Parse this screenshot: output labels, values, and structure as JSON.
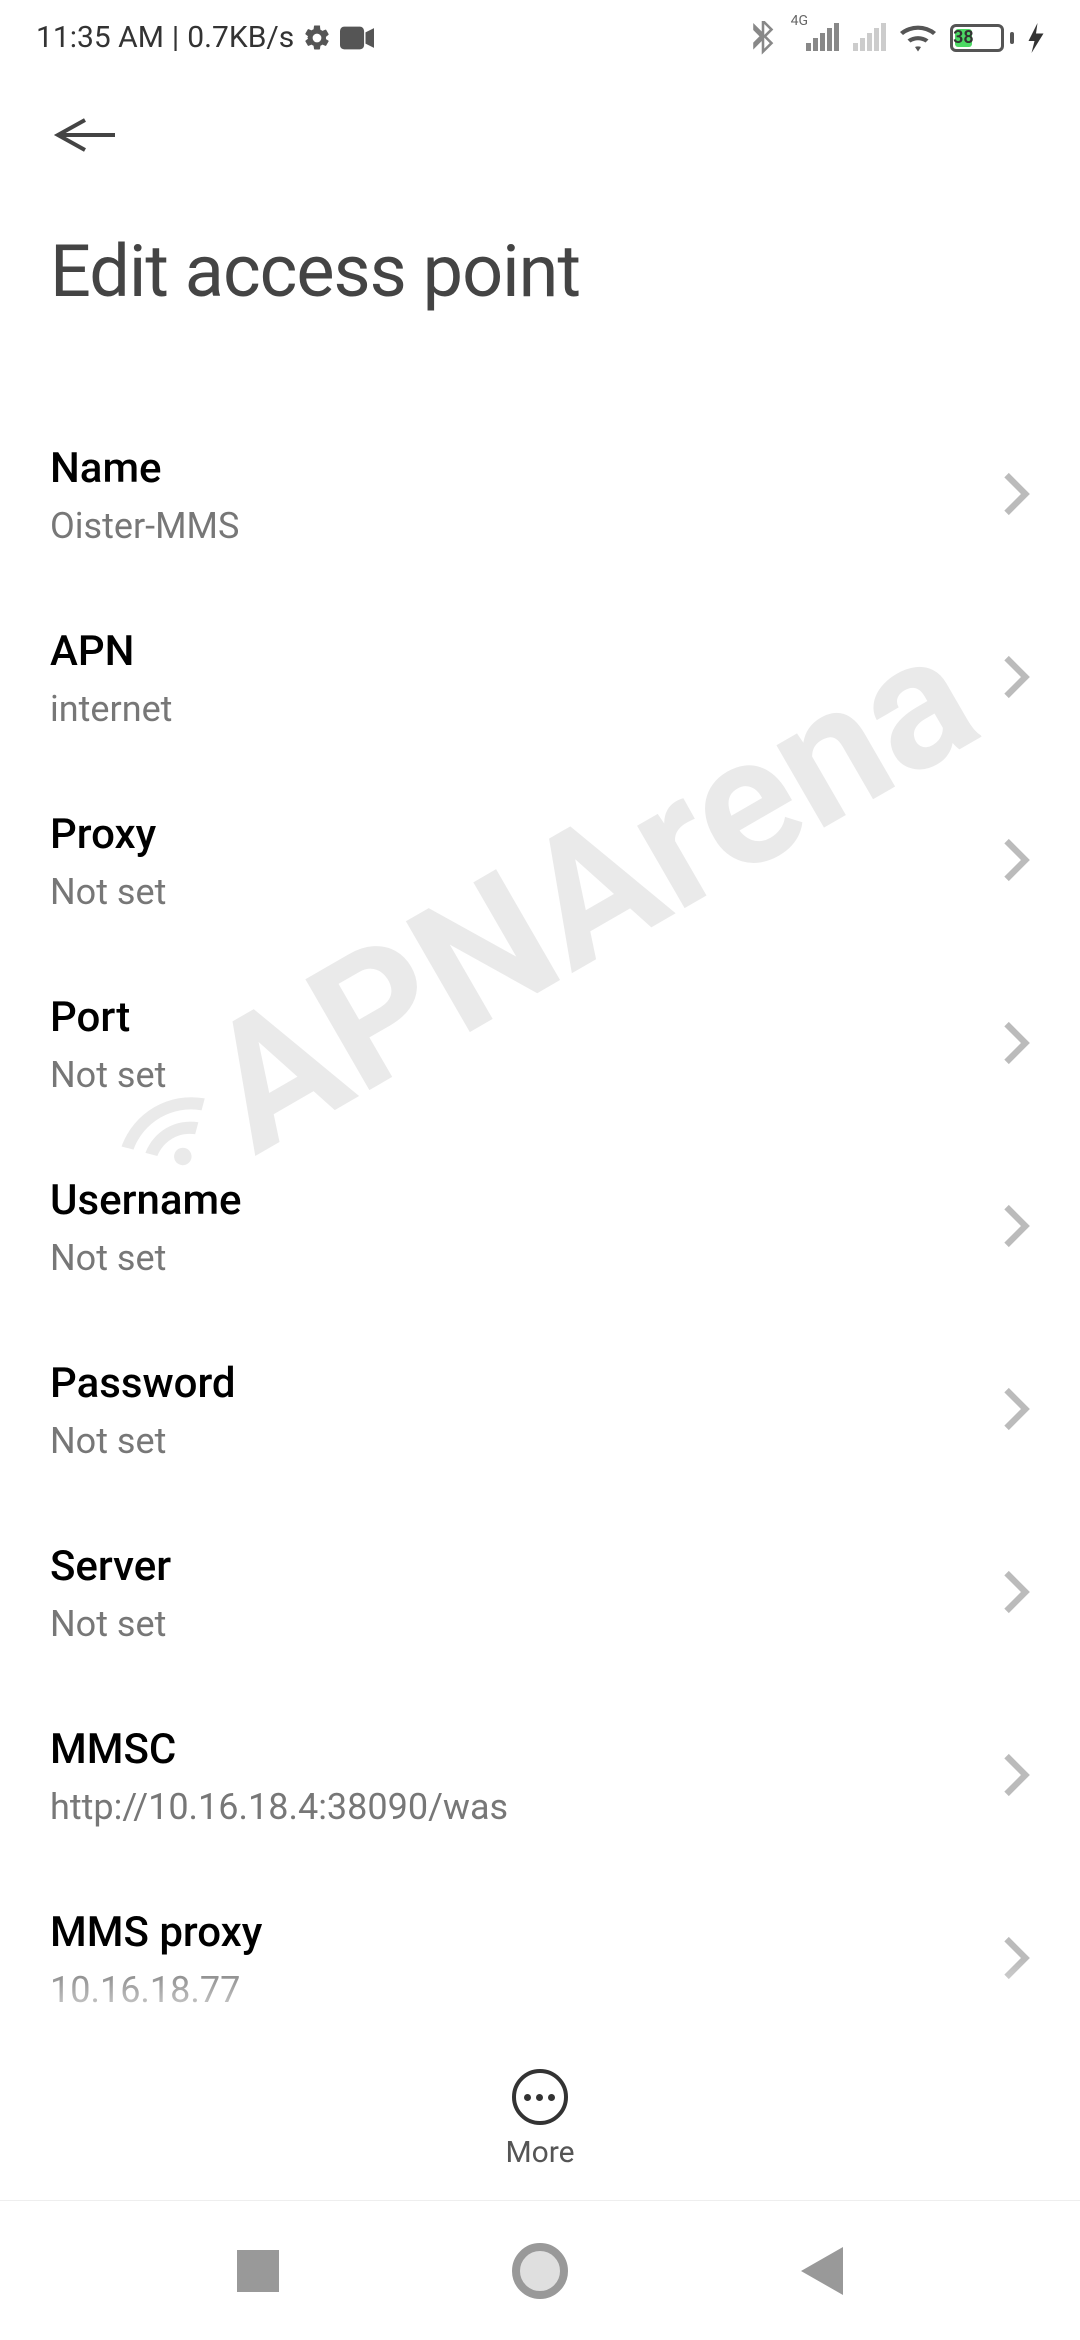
{
  "status_bar": {
    "time": "11:35 AM",
    "data_rate": "0.7KB/s",
    "network_label": "4G",
    "battery_percent": "38"
  },
  "header": {
    "title": "Edit access point"
  },
  "settings": [
    {
      "label": "Name",
      "value": "Oister-MMS"
    },
    {
      "label": "APN",
      "value": "internet"
    },
    {
      "label": "Proxy",
      "value": "Not set"
    },
    {
      "label": "Port",
      "value": "Not set"
    },
    {
      "label": "Username",
      "value": "Not set"
    },
    {
      "label": "Password",
      "value": "Not set"
    },
    {
      "label": "Server",
      "value": "Not set"
    },
    {
      "label": "MMSC",
      "value": "http://10.16.18.4:38090/was"
    },
    {
      "label": "MMS proxy",
      "value": "10.16.18.77"
    }
  ],
  "bottom": {
    "more_label": "More"
  },
  "watermark": "APNArena"
}
